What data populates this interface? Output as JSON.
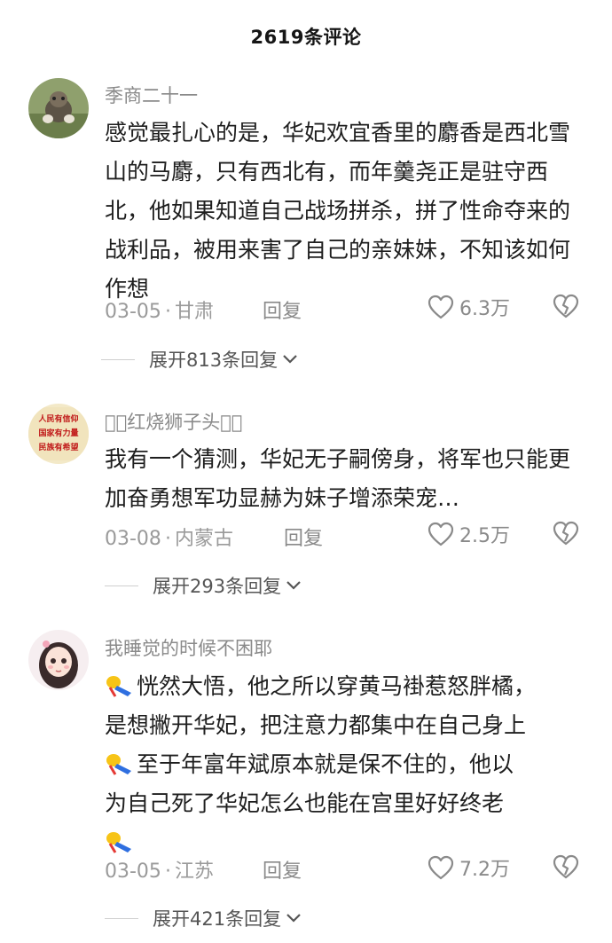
{
  "header": {
    "title": "2619条评论"
  },
  "comments": [
    {
      "author": "季商二十一",
      "text": "感觉最扎心的是，华妃欢宜香里的麝香是西北雪山的马麝，只有西北有，而年羹尧正是驻守西北，他如果知道自己战场拼杀，拼了性命夺来的战利品，被用来害了自己的亲妹妹，不知该如何作想",
      "date": "03-05",
      "location": "甘肃",
      "reply": "回复",
      "likes": "6.3万",
      "expand": "展开813条回复"
    },
    {
      "author": "ꪔ⃝红烧狮子头ꪔ⃝",
      "avatar_text": [
        "人民有信仰",
        "国家有力量",
        "民族有希望"
      ],
      "text": "我有一个猜测，华妃无子嗣傍身，将军也只能更加奋勇想军功显赫为妹子增添荣宠…",
      "date": "03-08",
      "location": "内蒙古",
      "reply": "回复",
      "likes": "2.5万",
      "expand": "展开293条回复"
    },
    {
      "author": "我睡觉的时候不困耶",
      "lines": [
        "恍然大悟，他之所以穿黄马褂惹怒胖橘，",
        "是想撇开华妃，把注意力都集中在自己身上",
        "至于年富年斌原本就是保不住的，他以",
        "为自己死了华妃怎么也能在宫里好好终老"
      ],
      "date": "03-05",
      "location": "江苏",
      "reply": "回复",
      "likes": "7.2万",
      "expand": "展开421条回复"
    }
  ],
  "icons": {
    "like": "heart-outline-icon",
    "dislike": "broken-heart-icon",
    "expand": "chevron-down-icon",
    "emoji": "lying-down-emoji-icon"
  }
}
